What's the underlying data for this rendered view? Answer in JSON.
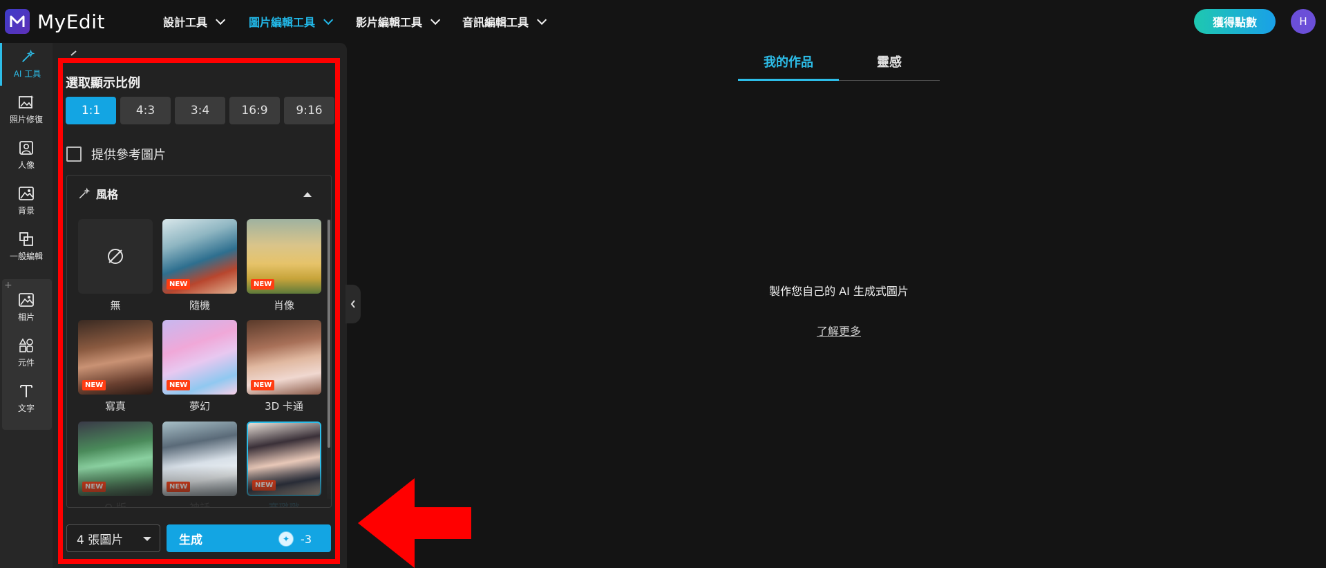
{
  "brand": {
    "name": "MyEdit",
    "logo_letter": "M"
  },
  "nav": [
    {
      "label": "設計工具",
      "active": false
    },
    {
      "label": "圖片編輯工具",
      "active": true
    },
    {
      "label": "影片編輯工具",
      "active": false
    },
    {
      "label": "音訊編輯工具",
      "active": false
    }
  ],
  "header": {
    "credits_button": "獲得點數",
    "avatar_initial": "H"
  },
  "rail": [
    {
      "label": "AI 工具",
      "icon": "magic-wand-icon",
      "active": true
    },
    {
      "label": "照片修復",
      "icon": "photo-repair-icon"
    },
    {
      "label": "人像",
      "icon": "portrait-icon"
    },
    {
      "label": "背景",
      "icon": "background-icon"
    },
    {
      "label": "一般編輯",
      "icon": "general-edit-icon"
    },
    {
      "label": "相片",
      "icon": "photo-icon"
    },
    {
      "label": "元件",
      "icon": "elements-icon"
    },
    {
      "label": "文字",
      "icon": "text-icon"
    }
  ],
  "panel": {
    "ratio_title": "選取顯示比例",
    "ratios": [
      "1:1",
      "4:3",
      "3:4",
      "16:9",
      "9:16"
    ],
    "selected_ratio": "1:1",
    "reference_label": "提供參考圖片",
    "style_title": "風格",
    "styles": [
      {
        "label": "無",
        "new": false,
        "none": true
      },
      {
        "label": "隨機",
        "new": true
      },
      {
        "label": "肖像",
        "new": true
      },
      {
        "label": "寫真",
        "new": true
      },
      {
        "label": "夢幻",
        "new": true
      },
      {
        "label": "3D 卡通",
        "new": true
      },
      {
        "label": "Q 版",
        "new": true
      },
      {
        "label": "神話",
        "new": true
      },
      {
        "label": "賽璐璐",
        "new": true,
        "selected": true
      }
    ],
    "badge_text": "NEW",
    "image_count": "4 張圖片",
    "generate_label": "生成",
    "generate_cost": "-3"
  },
  "main": {
    "tabs": [
      "我的作品",
      "靈感"
    ],
    "empty_title": "製作您自己的 AI 生成式圖片",
    "learn_more": "了解更多"
  },
  "colors": {
    "accent": "#13a5e3",
    "highlight": "#ff0000",
    "badge": "#ff3d12"
  }
}
